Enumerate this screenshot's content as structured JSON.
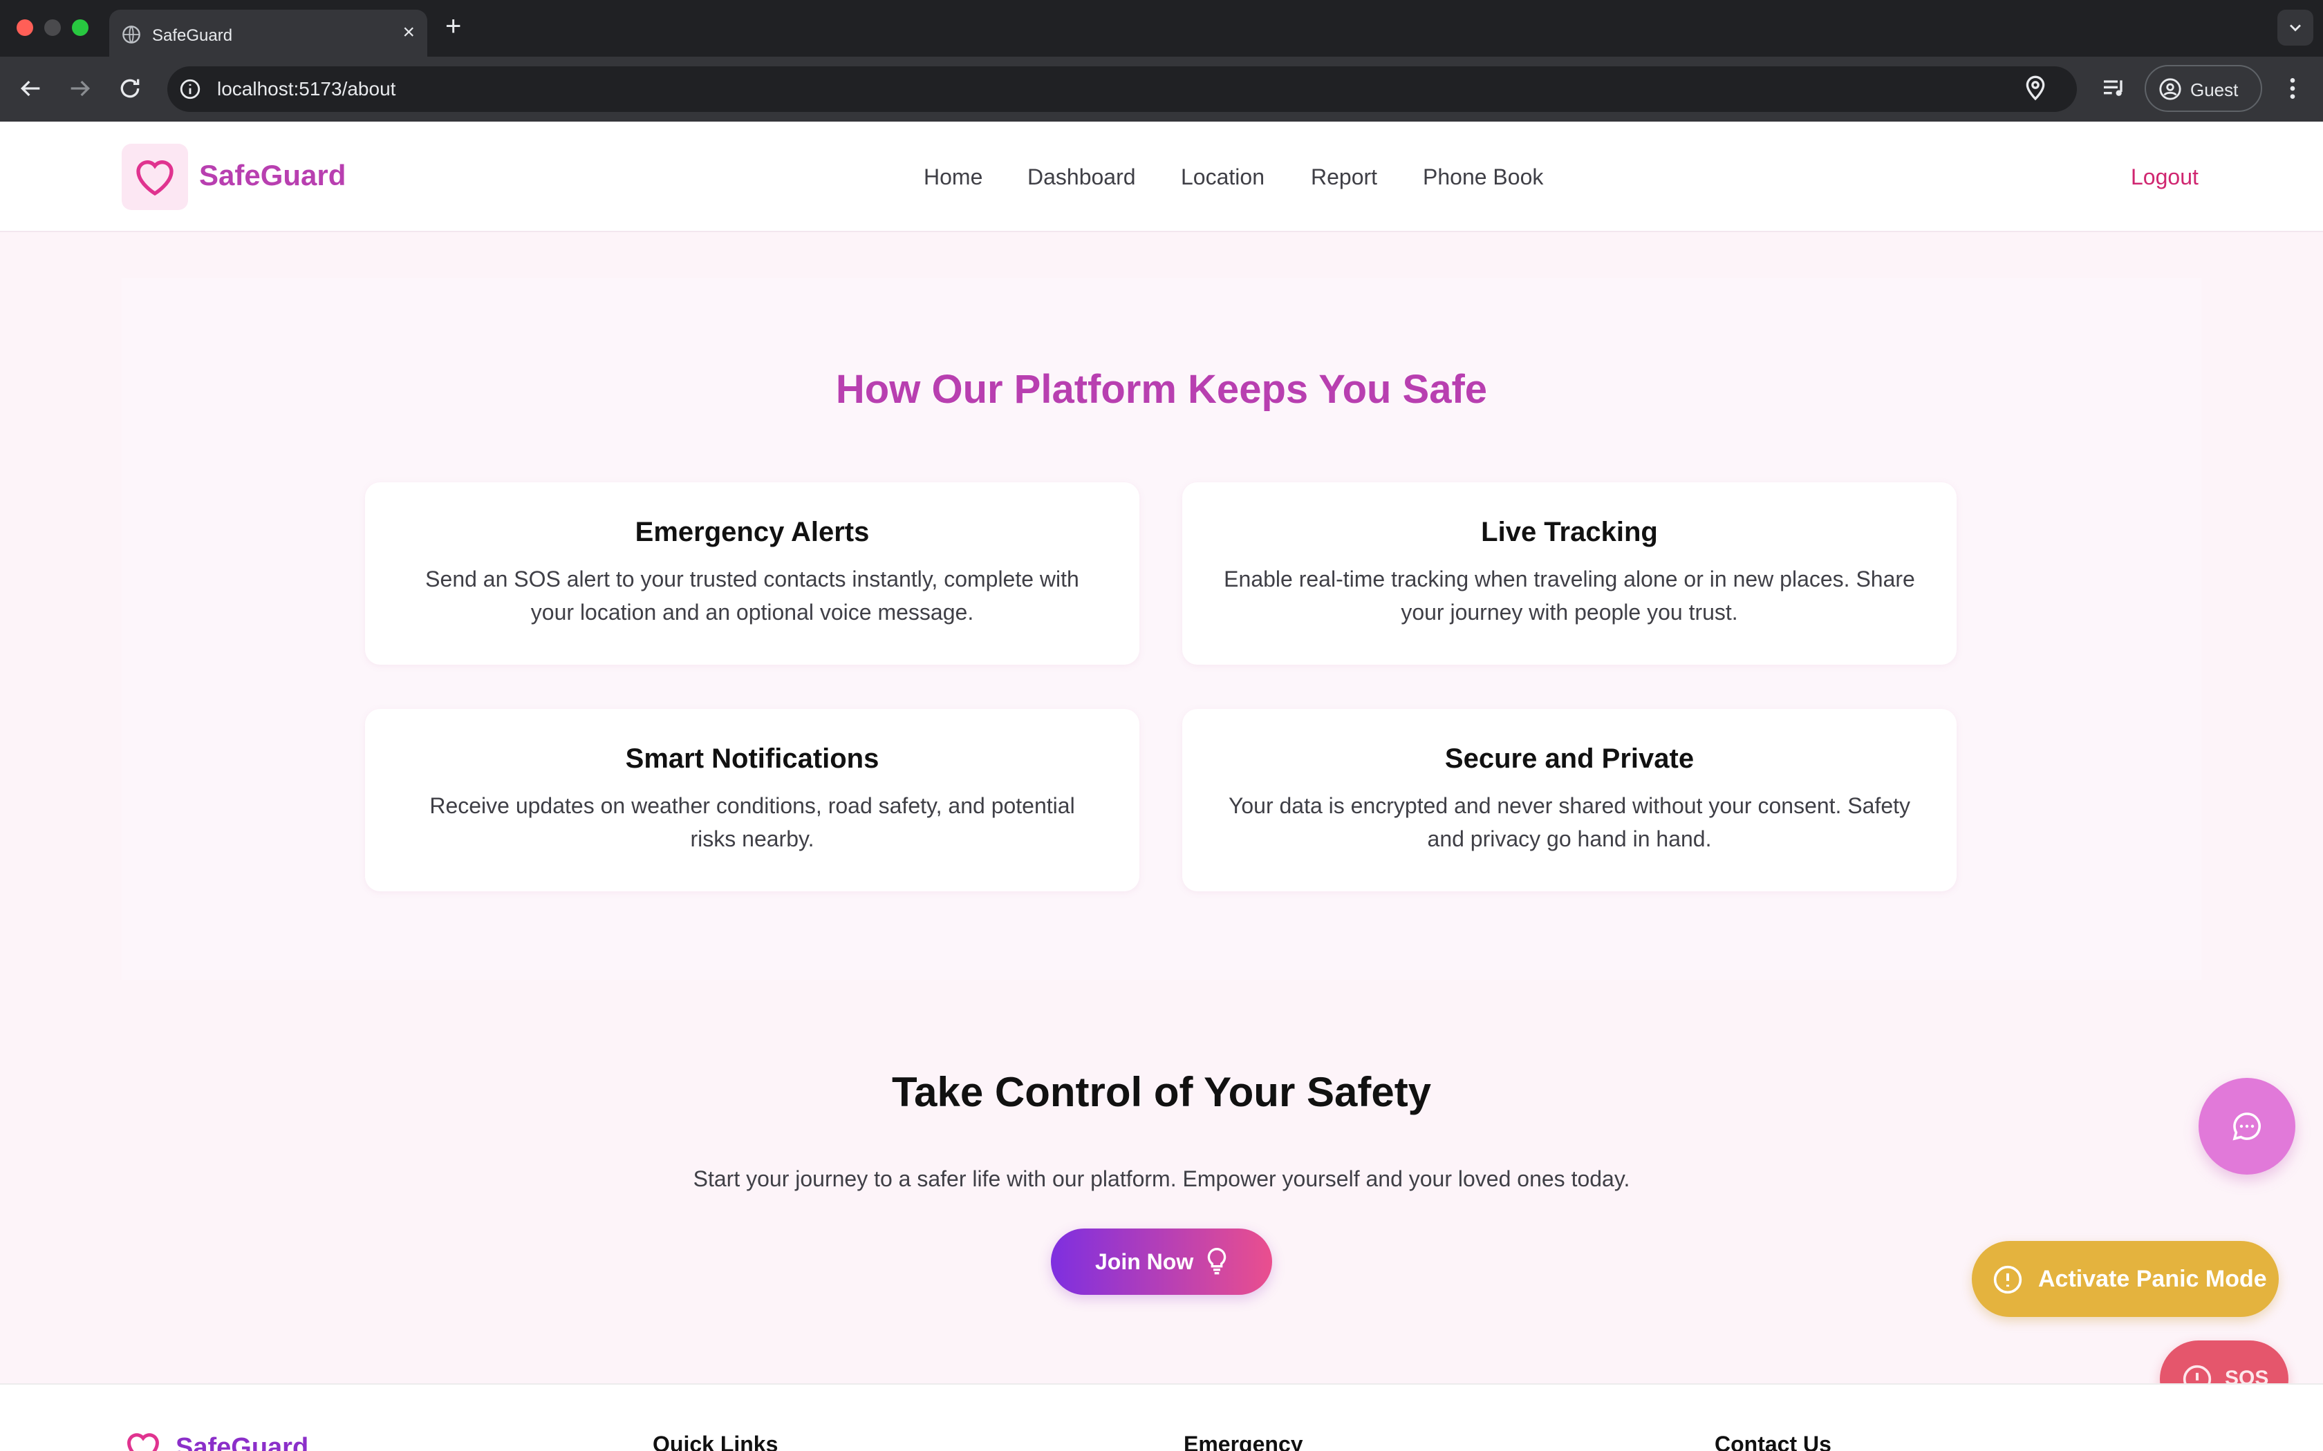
{
  "browser": {
    "tab_title": "SafeGuard",
    "tab_close": "×",
    "new_tab": "+",
    "url": "localhost:5173/about",
    "profile_label": "Guest"
  },
  "header": {
    "brand": "SafeGuard",
    "nav": [
      "Home",
      "Dashboard",
      "Location",
      "Report",
      "Phone Book"
    ],
    "logout": "Logout"
  },
  "features": {
    "title": "How Our Platform Keeps You Safe",
    "cards": [
      {
        "title": "Emergency Alerts",
        "desc": "Send an SOS alert to your trusted contacts instantly, complete with your location and an optional voice message."
      },
      {
        "title": "Live Tracking",
        "desc": "Enable real-time tracking when traveling alone or in new places. Share your journey with people you trust."
      },
      {
        "title": "Smart Notifications",
        "desc": "Receive updates on weather conditions, road safety, and potential risks nearby."
      },
      {
        "title": "Secure and Private",
        "desc": "Your data is encrypted and never shared without your consent. Safety and privacy go hand in hand."
      }
    ]
  },
  "cta": {
    "title": "Take Control of Your Safety",
    "desc": "Start your journey to a safer life with our platform. Empower yourself and your loved ones today.",
    "button": "Join Now"
  },
  "floating": {
    "panic": "Activate Panic Mode",
    "sos": "SOS"
  },
  "footer": {
    "brand": "SafeGuard",
    "columns": [
      "Quick Links",
      "Emergency",
      "Contact Us"
    ]
  },
  "colors": {
    "brand": "#b83fb0",
    "accent_pink": "#d02670",
    "panic": "#e4b33e",
    "sos": "#e5566c"
  }
}
